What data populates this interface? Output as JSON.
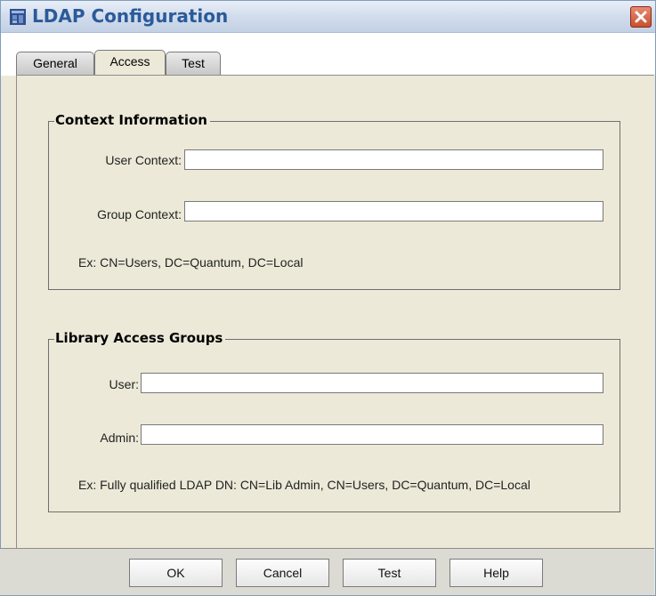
{
  "window": {
    "title": "LDAP Configuration"
  },
  "tabs": [
    {
      "label": "General",
      "active": false
    },
    {
      "label": "Access",
      "active": true
    },
    {
      "label": "Test",
      "active": false
    }
  ],
  "context_group": {
    "title": "Context Information",
    "user_context_label": "User Context:",
    "user_context_value": "",
    "group_context_label": "Group Context:",
    "group_context_value": "",
    "example": "Ex: CN=Users, DC=Quantum, DC=Local"
  },
  "library_group": {
    "title": "Library Access Groups",
    "user_label": "User:",
    "user_value": "",
    "admin_label": "Admin:",
    "admin_value": "",
    "example": "Ex: Fully qualified LDAP DN: CN=Lib Admin, CN=Users, DC=Quantum, DC=Local"
  },
  "buttons": {
    "ok": "OK",
    "cancel": "Cancel",
    "test": "Test",
    "help": "Help"
  },
  "icons": {
    "app": "app-window-icon",
    "close": "close-icon"
  },
  "colors": {
    "title_text": "#2a5a99",
    "panel_bg": "#ece9d8",
    "close_button": "#c8502f"
  }
}
